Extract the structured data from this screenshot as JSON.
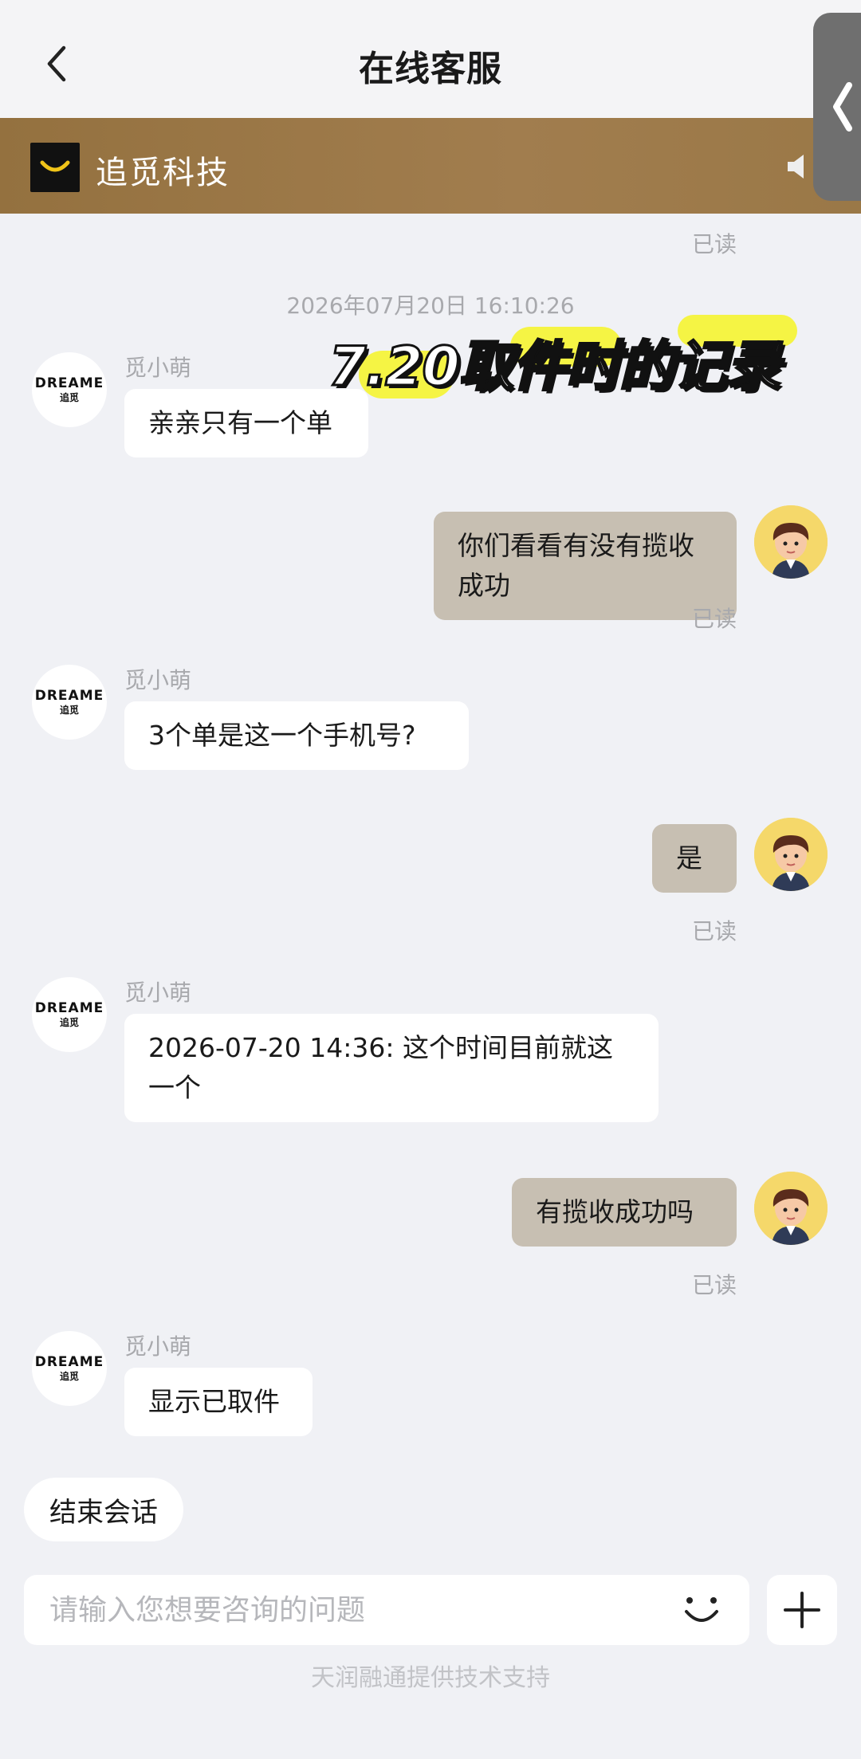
{
  "header": {
    "title": "在线客服"
  },
  "brand": {
    "name": "追觅科技"
  },
  "read_label": "已读",
  "timestamp": "2026年07月20日 16:10:26",
  "overlay_caption": "7.20取件时的记录",
  "agent": {
    "name": "觅小萌",
    "logo_text": "DREAME",
    "logo_sub": "追觅"
  },
  "messages": [
    {
      "from": "agent",
      "text": "亲亲只有一个单"
    },
    {
      "from": "user",
      "text": "你们看看有没有揽收成功",
      "status": "已读"
    },
    {
      "from": "agent",
      "text": "3个单是这一个手机号?"
    },
    {
      "from": "user",
      "text": "是",
      "status": "已读"
    },
    {
      "from": "agent",
      "text": "2026-07-20 14:36: 这个时间目前就这一个"
    },
    {
      "from": "user",
      "text": "有揽收成功吗",
      "status": "已读"
    },
    {
      "from": "agent",
      "text": "显示已取件"
    }
  ],
  "end_chat_label": "结束会话",
  "input": {
    "placeholder": "请输入您想要咨询的问题",
    "value": ""
  },
  "footer_note": "天润融通提供技术支持",
  "colors": {
    "brand_bar": "#9b7846",
    "user_bubble": "#c7bfb2",
    "background": "#f0f1f5"
  }
}
